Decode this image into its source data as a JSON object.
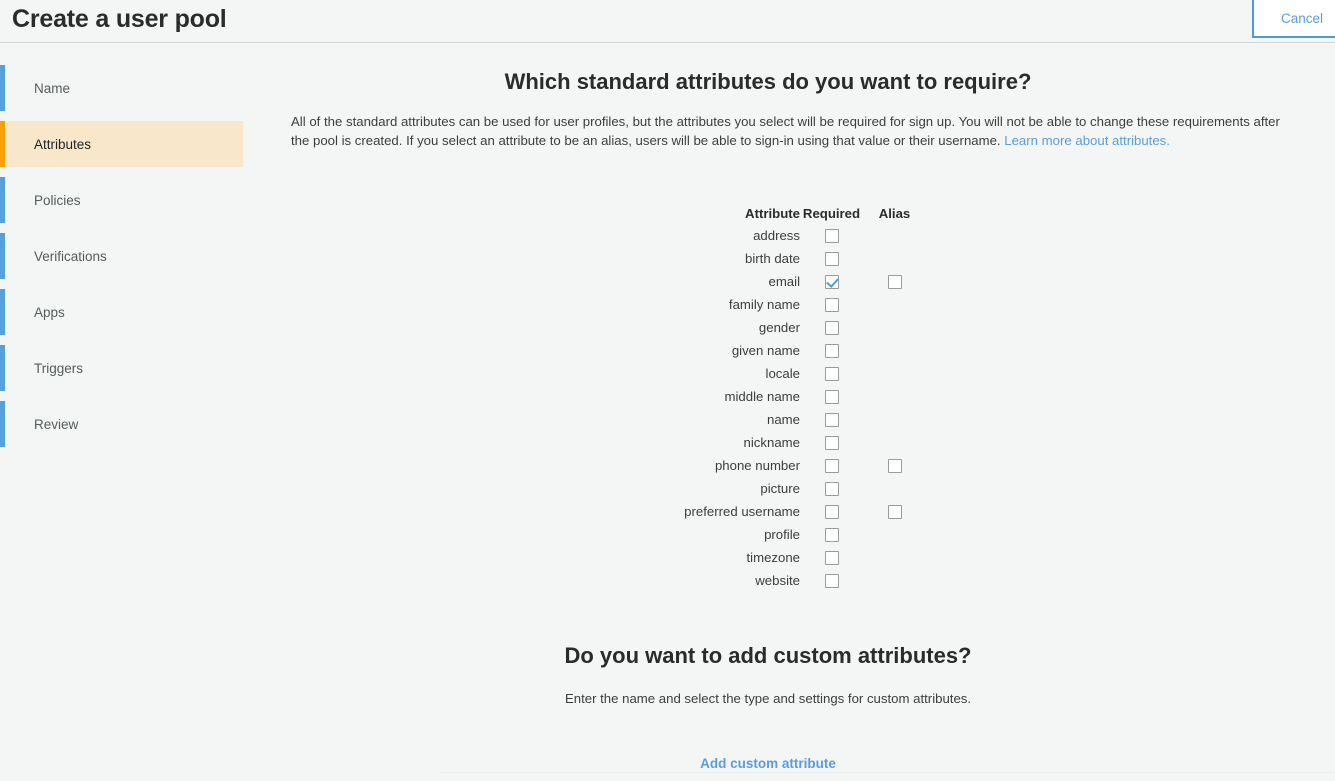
{
  "header": {
    "title": "Create a user pool",
    "cancel_label": "Cancel"
  },
  "sidebar": {
    "items": [
      {
        "label": "Name",
        "active": false
      },
      {
        "label": "Attributes",
        "active": true
      },
      {
        "label": "Policies",
        "active": false
      },
      {
        "label": "Verifications",
        "active": false
      },
      {
        "label": "Apps",
        "active": false
      },
      {
        "label": "Triggers",
        "active": false
      },
      {
        "label": "Review",
        "active": false
      }
    ]
  },
  "main": {
    "standard_section": {
      "heading": "Which standard attributes do you want to require?",
      "description_part1": "All of the standard attributes can be used for user profiles, but the attributes you select will be required for sign up. You will not be able to change these requirements after the pool is created. If you select an attribute to be an alias, users will be able to sign-in using that value or their username. ",
      "link_text": "Learn more about attributes.",
      "table": {
        "headers": {
          "attribute": "Attribute",
          "required": "Required",
          "alias": "Alias"
        },
        "rows": [
          {
            "name": "address",
            "required": false,
            "has_alias": false,
            "alias": false
          },
          {
            "name": "birth date",
            "required": false,
            "has_alias": false,
            "alias": false
          },
          {
            "name": "email",
            "required": true,
            "has_alias": true,
            "alias": false
          },
          {
            "name": "family name",
            "required": false,
            "has_alias": false,
            "alias": false
          },
          {
            "name": "gender",
            "required": false,
            "has_alias": false,
            "alias": false
          },
          {
            "name": "given name",
            "required": false,
            "has_alias": false,
            "alias": false
          },
          {
            "name": "locale",
            "required": false,
            "has_alias": false,
            "alias": false
          },
          {
            "name": "middle name",
            "required": false,
            "has_alias": false,
            "alias": false
          },
          {
            "name": "name",
            "required": false,
            "has_alias": false,
            "alias": false
          },
          {
            "name": "nickname",
            "required": false,
            "has_alias": false,
            "alias": false
          },
          {
            "name": "phone number",
            "required": false,
            "has_alias": true,
            "alias": false
          },
          {
            "name": "picture",
            "required": false,
            "has_alias": false,
            "alias": false
          },
          {
            "name": "preferred username",
            "required": false,
            "has_alias": true,
            "alias": false
          },
          {
            "name": "profile",
            "required": false,
            "has_alias": false,
            "alias": false
          },
          {
            "name": "timezone",
            "required": false,
            "has_alias": false,
            "alias": false
          },
          {
            "name": "website",
            "required": false,
            "has_alias": false,
            "alias": false
          }
        ]
      }
    },
    "custom_section": {
      "heading": "Do you want to add custom attributes?",
      "description": "Enter the name and select the type and settings for custom attributes.",
      "add_link": "Add custom attribute"
    }
  },
  "colors": {
    "accent_blue": "#5b9dd9",
    "active_bar_orange": "#f5a106",
    "active_row_bg": "#f9e7cc",
    "nav_bar_blue": "#55a0dd",
    "page_bg": "#f4f6f6"
  }
}
